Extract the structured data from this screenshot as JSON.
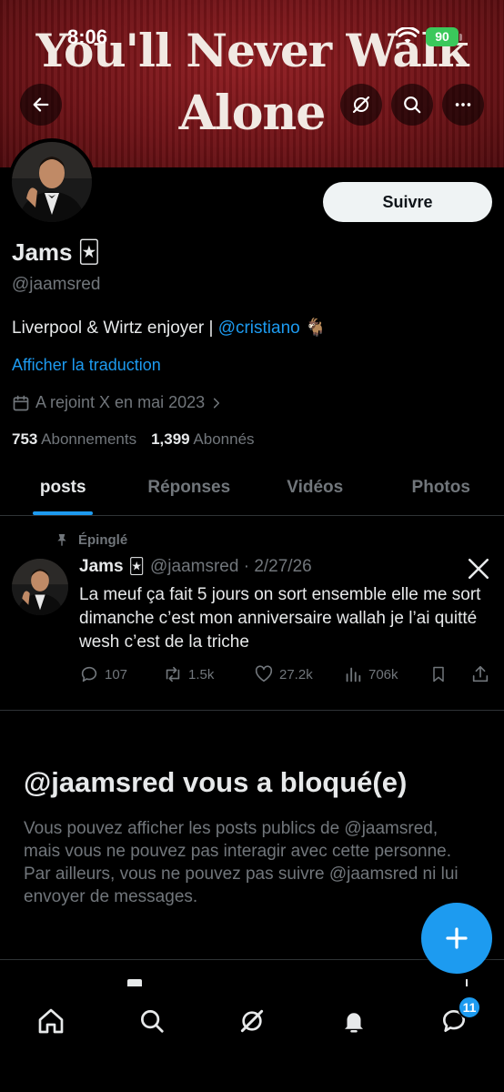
{
  "status_bar": {
    "time": "8:06",
    "battery": "90"
  },
  "banner": {
    "line1": "You'll Never Walk",
    "line2": "Alone"
  },
  "header": {
    "back_icon": "arrow-left-icon",
    "grok_icon": "grok-icon",
    "search_icon": "search-icon",
    "more_icon": "more-icon"
  },
  "profile": {
    "follow_label": "Suivre",
    "display_name": "Jams",
    "name_emoji": "🃏",
    "handle": "@jaamsred",
    "bio_text": "Liverpool & Wirtz enjoyer | ",
    "bio_mention": "@cristiano",
    "bio_emoji": "🐐",
    "translate_label": "Afficher la traduction",
    "joined": "A rejoint X en mai 2023",
    "following_count": "753",
    "following_label": "Abonnements",
    "followers_count": "1,399",
    "followers_label": "Abonnés"
  },
  "tabs": [
    {
      "label": "posts",
      "active": true
    },
    {
      "label": "Réponses",
      "active": false
    },
    {
      "label": "Vidéos",
      "active": false
    },
    {
      "label": "Photos",
      "active": false
    }
  ],
  "pinned_post": {
    "pinned_label": "Épinglé",
    "author": "Jams",
    "author_emoji": "🃏",
    "meta": "@jaamsred · 2/27/26",
    "platform_icon": "x-logo-icon",
    "text": "La meuf ça fait 5 jours on sort ensemble elle me sort dimanche c’est mon anniversaire wallah je l’ai quitté wesh c’est de la triche",
    "replies": "107",
    "reposts": "1.5k",
    "likes": "27.2k",
    "views": "706k"
  },
  "blocked": {
    "title": "@jaamsred vous a bloqué(e)",
    "body": "Vous pouvez afficher les posts publics de @jaamsred, mais vous ne pouvez pas interagir avec cette personne. Par ailleurs, vous ne pouvez pas suivre @jaamsred ni lui envoyer de messages."
  },
  "bottom_nav": {
    "items": [
      "home-icon",
      "search-icon",
      "grok-icon",
      "notifications-icon",
      "messages-icon"
    ],
    "messages_badge": "11"
  },
  "colors": {
    "accent": "#1d9bf0",
    "background": "#000000",
    "muted": "#71767b",
    "banner_red": "#7a161a"
  }
}
